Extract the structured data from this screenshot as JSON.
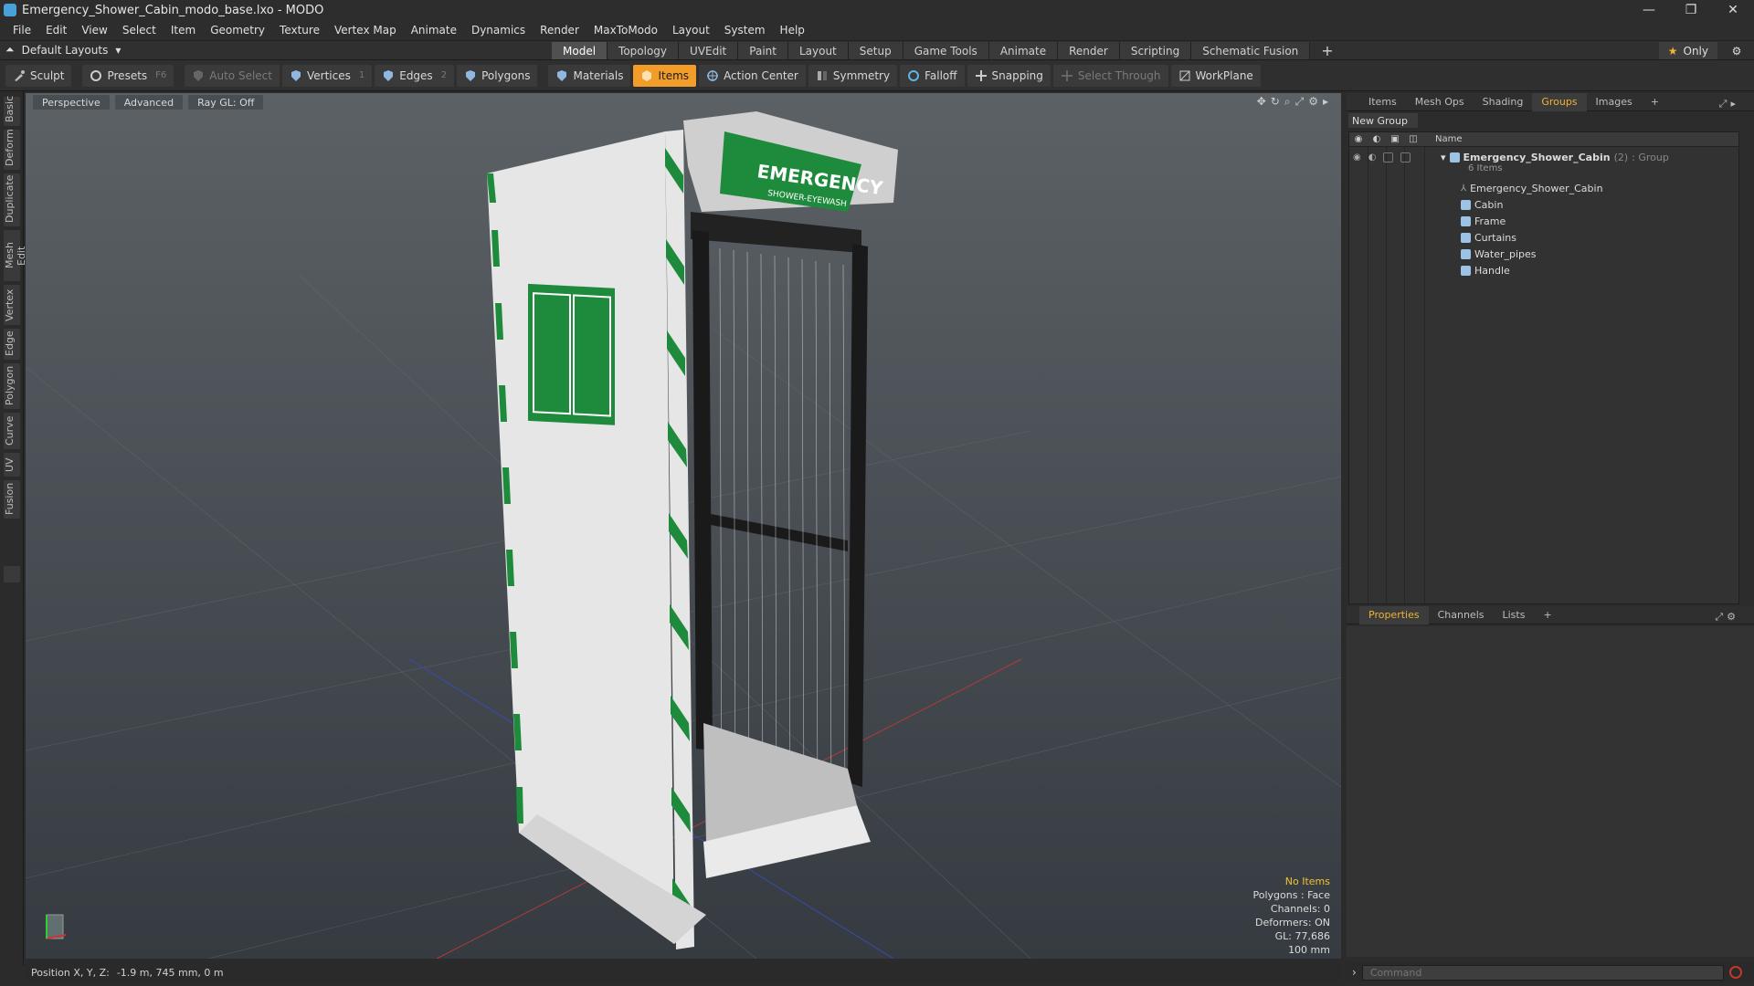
{
  "window": {
    "title": "Emergency_Shower_Cabin_modo_base.lxo - MODO",
    "min": "—",
    "max": "❐",
    "close": "✕"
  },
  "menu": [
    "File",
    "Edit",
    "View",
    "Select",
    "Item",
    "Geometry",
    "Texture",
    "Vertex Map",
    "Animate",
    "Dynamics",
    "Render",
    "MaxToModo",
    "Layout",
    "System",
    "Help"
  ],
  "layout": {
    "dropdown": "Default Layouts",
    "modes": [
      "Model",
      "Topology",
      "UVEdit",
      "Paint",
      "Layout",
      "Setup",
      "Game Tools",
      "Animate",
      "Render",
      "Scripting",
      "Schematic Fusion"
    ],
    "active_mode": "Model",
    "only": "Only"
  },
  "toolbar": {
    "sculpt": "Sculpt",
    "presets": "Presets",
    "presets_key": "F6",
    "auto_select": "Auto Select",
    "vertices": "Vertices",
    "vertices_key": "1",
    "edges": "Edges",
    "edges_key": "2",
    "polygons": "Polygons",
    "materials": "Materials",
    "items": "Items",
    "action_center": "Action Center",
    "symmetry": "Symmetry",
    "falloff": "Falloff",
    "snapping": "Snapping",
    "select_through": "Select Through",
    "workplane": "WorkPlane"
  },
  "left_tabs": [
    "Basic",
    "Deform",
    "Duplicate",
    "Mesh Edit",
    "Vertex",
    "Edge",
    "Polygon",
    "Curve",
    "UV",
    "Fusion"
  ],
  "viewport": {
    "view": "Perspective",
    "shading": "Advanced",
    "raygl": "Ray GL: Off",
    "stats": {
      "items": "No Items",
      "polygons": "Polygons : Face",
      "channels": "Channels: 0",
      "deformers": "Deformers: ON",
      "gl": "GL: 77,686",
      "scale": "100 mm"
    },
    "sign_text": "EMERGENCY",
    "sign_sub": "SHOWER-EYEWASH"
  },
  "status": {
    "label": "Position X, Y, Z:",
    "value": "-1.9 m, 745 mm, 0 m"
  },
  "panel": {
    "tabs": [
      "Items",
      "Mesh Ops",
      "Shading",
      "Groups",
      "Images"
    ],
    "active_tab": "Groups",
    "new_group": "New Group",
    "name_col": "Name",
    "group": {
      "name": "Emergency_Shower_Cabin",
      "count": "(2)",
      "type": ": Group",
      "items": "6 Items"
    },
    "children": [
      "Emergency_Shower_Cabin",
      "Cabin",
      "Frame",
      "Curtains",
      "Water_pipes",
      "Handle"
    ],
    "prop_tabs": [
      "Properties",
      "Channels",
      "Lists"
    ],
    "active_prop": "Properties",
    "command_placeholder": "Command"
  },
  "colors": {
    "accent": "#f29d2a",
    "sign_green": "#1e8a3c"
  }
}
